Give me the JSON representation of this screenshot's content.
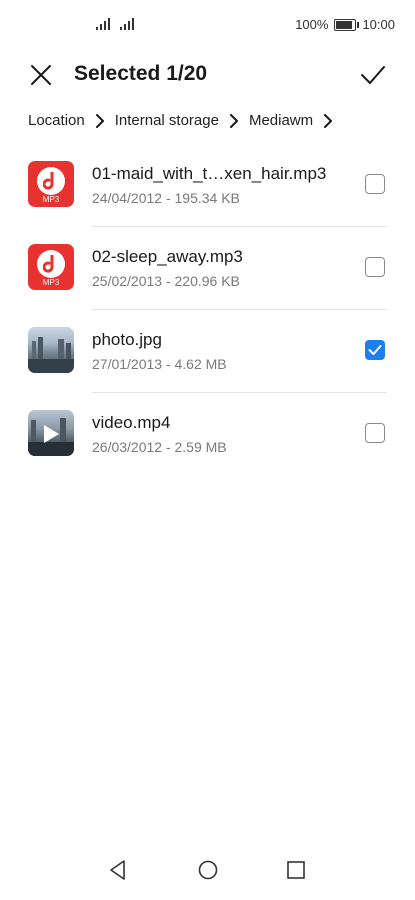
{
  "status_bar": {
    "battery": "100%",
    "time": "10:00",
    "battery_level": 0.85
  },
  "header": {
    "title": "Selected 1/20",
    "close_icon": "close-icon",
    "confirm_icon": "checkmark-icon"
  },
  "breadcrumb": [
    "Location",
    "Internal storage",
    "Mediawm"
  ],
  "files": [
    {
      "name": "01-maid_with_t…xen_hair.mp3",
      "meta": "24/04/2012 - 195.34 KB",
      "type": "mp3",
      "thumb_label": "MP3",
      "checked": false
    },
    {
      "name": "02-sleep_away.mp3",
      "meta": "25/02/2013 - 220.96 KB",
      "type": "mp3",
      "thumb_label": "MP3",
      "checked": false
    },
    {
      "name": "photo.jpg",
      "meta": "27/01/2013 - 4.62 MB",
      "type": "photo",
      "checked": true
    },
    {
      "name": "video.mp4",
      "meta": "26/03/2012 - 2.59 MB",
      "type": "video",
      "checked": false
    }
  ],
  "colors": {
    "accent": "#1e7ff0",
    "mp3_icon": "#e8322f"
  },
  "nav": [
    "back-icon",
    "home-icon",
    "recents-icon"
  ]
}
